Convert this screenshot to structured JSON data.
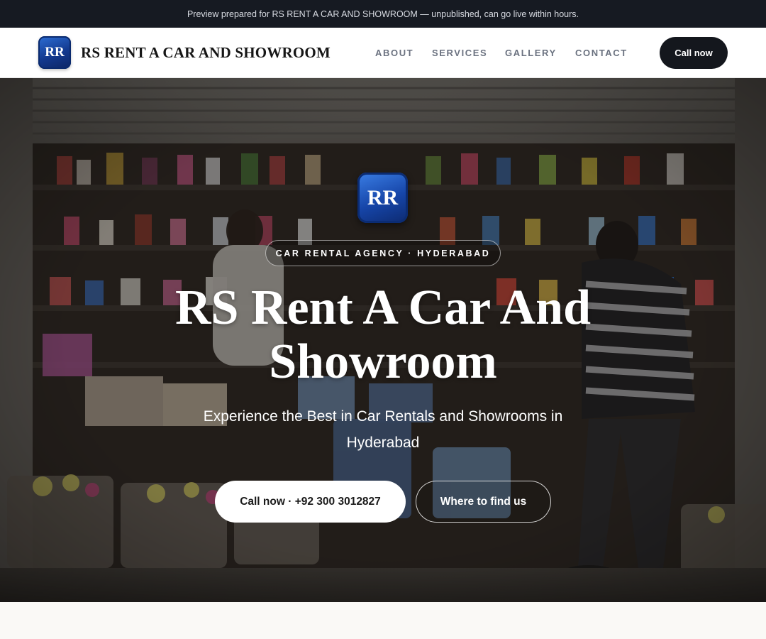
{
  "announcement": "Preview prepared for RS RENT A CAR AND SHOWROOM — unpublished, can go live within hours.",
  "header": {
    "logo_initials": "RR",
    "brand_name": "RS RENT A CAR AND SHOWROOM",
    "nav": [
      "ABOUT",
      "SERVICES",
      "GALLERY",
      "CONTACT"
    ],
    "cta_label": "Call now"
  },
  "hero": {
    "logo_initials": "RR",
    "eyebrow": "CAR RENTAL AGENCY · HYDERABAD",
    "title": "RS Rent A Car And Showroom",
    "subtitle": "Experience the Best in Car Rentals and Showrooms in Hyderabad",
    "primary_button": "Call now · +92 300 3012827",
    "secondary_button": "Where to find us",
    "background_image": "shop-storefront-photo"
  },
  "colors": {
    "topbar_bg": "#161a22",
    "cta_bg": "#14171d",
    "logo_blue": "#1645a8",
    "page_bg": "#faf9f6"
  }
}
